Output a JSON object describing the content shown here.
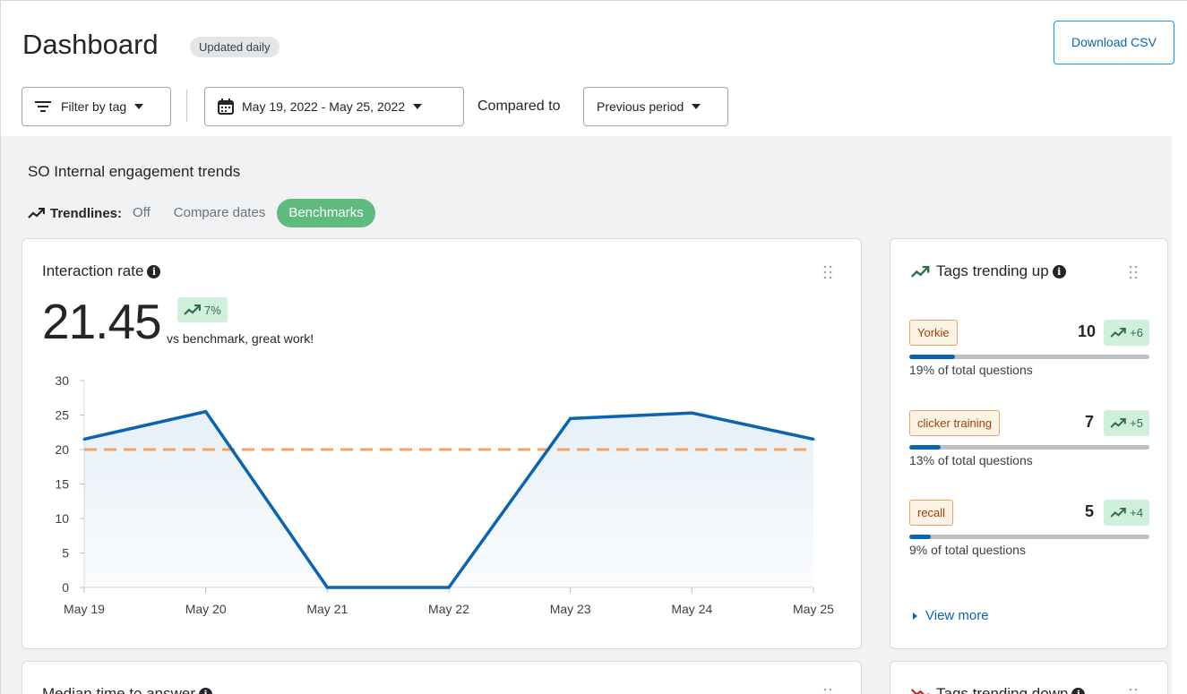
{
  "header": {
    "title": "Dashboard",
    "badge": "Updated daily",
    "download_label": "Download CSV"
  },
  "filters": {
    "filter_tag_label": "Filter by tag",
    "date_range_label": "May 19, 2022 - May 25, 2022",
    "compared_to_label": "Compared to",
    "compare_option": "Previous period"
  },
  "section": {
    "title": "SO Internal engagement trends",
    "trendlines_label": "Trendlines:",
    "trend_options": [
      "Off",
      "Compare dates",
      "Benchmarks"
    ],
    "active_option": "Benchmarks"
  },
  "interaction_card": {
    "title": "Interaction rate",
    "value": "21.45",
    "change": "7%",
    "subtitle": "vs benchmark, great work!"
  },
  "chart_data": {
    "type": "line",
    "categories": [
      "May 19",
      "May 20",
      "May 21",
      "May 22",
      "May 23",
      "May 24",
      "May 25"
    ],
    "series": [
      {
        "values": [
          21.5,
          25.5,
          0,
          0,
          24.5,
          25.3,
          21.5
        ],
        "color": "#0a64b0"
      }
    ],
    "benchmark": {
      "value": 20,
      "color": "#f4a261",
      "style": "dashed"
    },
    "y_ticks": [
      "0",
      "5",
      "10",
      "15",
      "20",
      "25",
      "30"
    ],
    "ylim": [
      0,
      30
    ],
    "grid": false
  },
  "tags_up": {
    "title": "Tags trending up",
    "items": [
      {
        "tag": "Yorkie",
        "count": "10",
        "delta": "+6",
        "pct_text": "19% of total questions",
        "fraction": 0.19
      },
      {
        "tag": "clicker training",
        "count": "7",
        "delta": "+5",
        "pct_text": "13% of total questions",
        "fraction": 0.13
      },
      {
        "tag": "recall",
        "count": "5",
        "delta": "+4",
        "pct_text": "9% of total questions",
        "fraction": 0.09
      }
    ],
    "view_more": "View more"
  },
  "median_card": {
    "title": "Median time to answer"
  },
  "tags_down": {
    "title": "Tags trending down"
  },
  "colors": {
    "accent_blue": "#0a64b0",
    "green_pill": "#5eba7d",
    "benchmark_orange": "#f4a261",
    "trend_down_red": "#c22e32"
  }
}
